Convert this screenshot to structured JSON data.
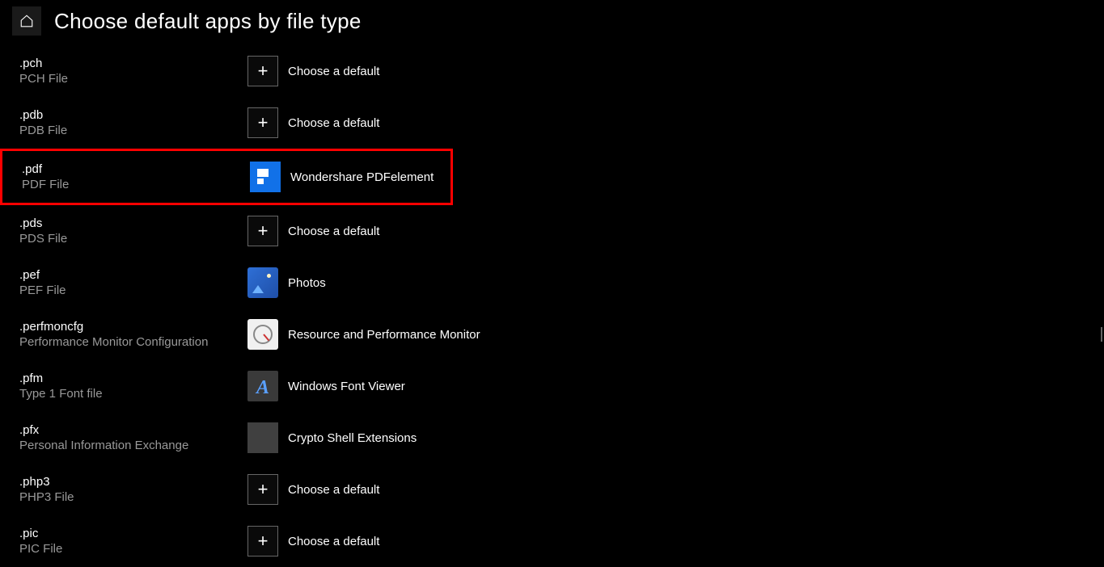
{
  "header": {
    "title": "Choose default apps by file type"
  },
  "rows": [
    {
      "ext": ".pch",
      "desc": "PCH File",
      "app": "Choose a default",
      "icon": "plus",
      "highlighted": false
    },
    {
      "ext": ".pdb",
      "desc": "PDB File",
      "app": "Choose a default",
      "icon": "plus",
      "highlighted": false
    },
    {
      "ext": ".pdf",
      "desc": "PDF File",
      "app": "Wondershare PDFelement",
      "icon": "pdfelement",
      "highlighted": true
    },
    {
      "ext": ".pds",
      "desc": "PDS File",
      "app": "Choose a default",
      "icon": "plus",
      "highlighted": false
    },
    {
      "ext": ".pef",
      "desc": "PEF File",
      "app": "Photos",
      "icon": "photos",
      "highlighted": false
    },
    {
      "ext": ".perfmoncfg",
      "desc": "Performance Monitor Configuration",
      "app": "Resource and Performance Monitor",
      "icon": "perfmon",
      "highlighted": false
    },
    {
      "ext": ".pfm",
      "desc": "Type 1 Font file",
      "app": "Windows Font Viewer",
      "icon": "fontviewer",
      "highlighted": false
    },
    {
      "ext": ".pfx",
      "desc": "Personal Information Exchange",
      "app": "Crypto Shell Extensions",
      "icon": "crypto",
      "highlighted": false
    },
    {
      "ext": ".php3",
      "desc": "PHP3 File",
      "app": "Choose a default",
      "icon": "plus",
      "highlighted": false
    },
    {
      "ext": ".pic",
      "desc": "PIC File",
      "app": "Choose a default",
      "icon": "plus",
      "highlighted": false
    }
  ]
}
